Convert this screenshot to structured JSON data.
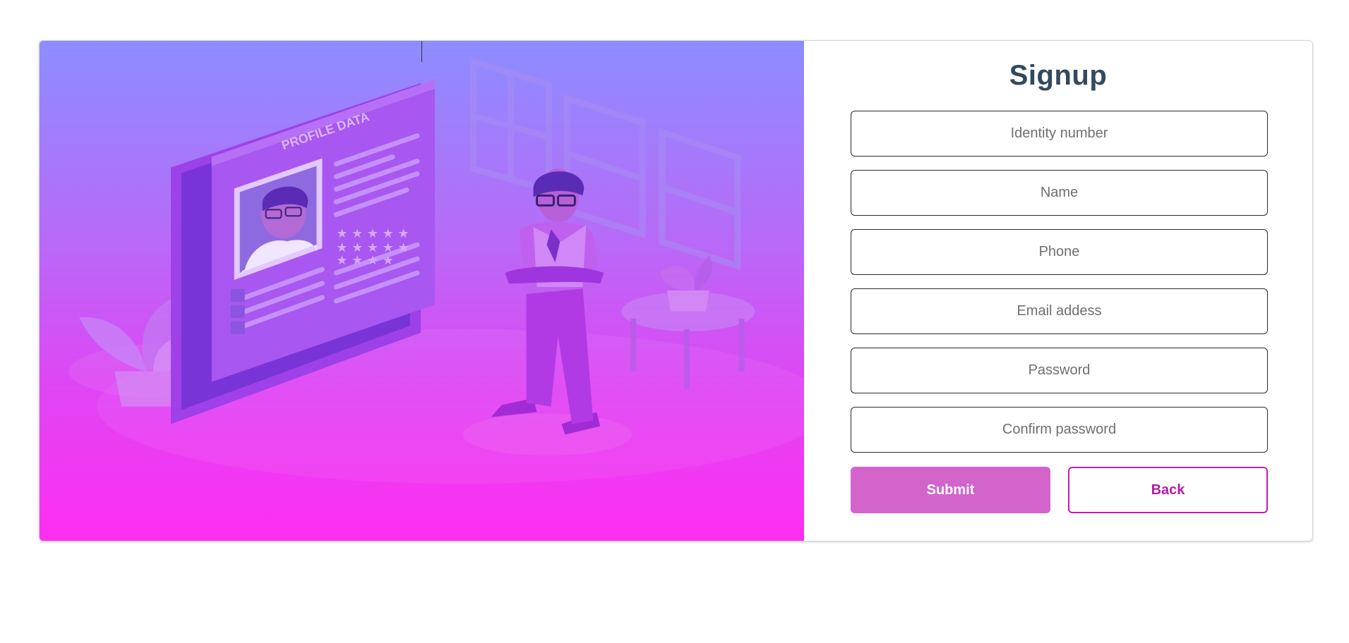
{
  "signup": {
    "title": "Signup",
    "fields": {
      "identity": {
        "placeholder": "Identity number",
        "value": ""
      },
      "name": {
        "placeholder": "Name",
        "value": ""
      },
      "phone": {
        "placeholder": "Phone",
        "value": ""
      },
      "email": {
        "placeholder": "Email addess",
        "value": ""
      },
      "password": {
        "placeholder": "Password",
        "value": ""
      },
      "confirm_password": {
        "placeholder": "Confirm password",
        "value": ""
      }
    },
    "submit_label": "Submit",
    "back_label": "Back"
  },
  "illustration": {
    "profile_card_title": "PROFILE DATA"
  },
  "colors": {
    "title": "#34495e",
    "submit_bg": "#d264cc",
    "back_border": "#c21cb8",
    "back_text": "#b01ea8",
    "gradient_top": "#8d8dff",
    "gradient_bottom": "#fe2ef0"
  }
}
